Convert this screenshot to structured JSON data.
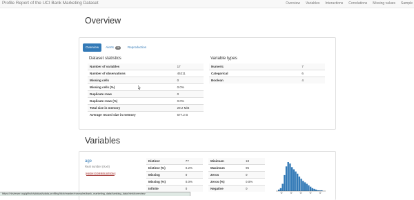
{
  "navbar": {
    "brand": "Profile Report of the UCI Bank Marketing Dataset",
    "links": [
      "Overview",
      "Variables",
      "Interactions",
      "Correlations",
      "Missing values",
      "Sample"
    ]
  },
  "overview": {
    "title": "Overview",
    "tabs": [
      {
        "label": "Overview",
        "active": true
      },
      {
        "label": "Alerts",
        "badge": "28"
      },
      {
        "label": "Reproduction"
      }
    ],
    "dataset_statistics": {
      "heading": "Dataset statistics",
      "rows": [
        {
          "label": "Number of variables",
          "value": "17"
        },
        {
          "label": "Number of observations",
          "value": "45211"
        },
        {
          "label": "Missing cells",
          "value": "0"
        },
        {
          "label": "Missing cells (%)",
          "value": "0.0%"
        },
        {
          "label": "Duplicate rows",
          "value": "0"
        },
        {
          "label": "Duplicate rows (%)",
          "value": "0.0%"
        },
        {
          "label": "Total size in memory",
          "value": "29.2 MiB"
        },
        {
          "label": "Average record size in memory",
          "value": "677.2 B"
        }
      ]
    },
    "variable_types": {
      "heading": "Variable types",
      "rows": [
        {
          "label": "Numeric",
          "value": "7"
        },
        {
          "label": "Categorical",
          "value": "6"
        },
        {
          "label": "Boolean",
          "value": "4"
        }
      ]
    }
  },
  "variables": {
    "title": "Variables",
    "variable": {
      "name": "age",
      "type": "Real number (ℝ≥0)",
      "warning": "HIGH CORRELATION",
      "stats_left": [
        {
          "label": "Distinct",
          "value": "77"
        },
        {
          "label": "Distinct (%)",
          "value": "0.2%"
        },
        {
          "label": "Missing",
          "value": "0"
        },
        {
          "label": "Missing (%)",
          "value": "0.0%"
        },
        {
          "label": "Infinite",
          "value": "0"
        }
      ],
      "stats_right": [
        {
          "label": "Minimum",
          "value": "18"
        },
        {
          "label": "Maximum",
          "value": "95"
        },
        {
          "label": "Zeros",
          "value": "0"
        },
        {
          "label": "Zeros (%)",
          "value": "0.0%"
        },
        {
          "label": "Negative",
          "value": "0"
        }
      ],
      "histogram": [
        2,
        4,
        10,
        22,
        34,
        40,
        38,
        33,
        30,
        27,
        24,
        20,
        17,
        14,
        12,
        10,
        8,
        6,
        4,
        3,
        2,
        1,
        1,
        1
      ]
    }
  },
  "status_bar": {
    "url": "https://nbviewer.org/github/ydataai/ydata-profiling/blob/master/examples/bank_marketing_data/banking_data.html#overview"
  },
  "colors": {
    "accent": "#337ab7",
    "warning_bg": "#f2dede",
    "warning_text": "#a94442"
  }
}
